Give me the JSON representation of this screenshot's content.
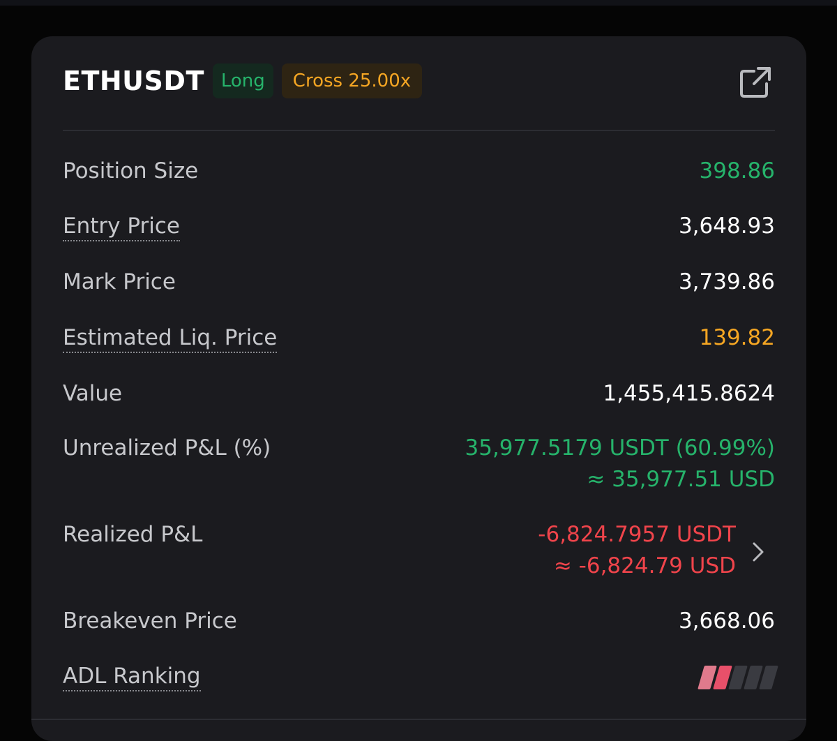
{
  "header": {
    "symbol": "ETHUSDT",
    "side_tag": "Long",
    "leverage_tag": "Cross 25.00x",
    "share_icon": "external-link-icon"
  },
  "rows": {
    "position_size": {
      "label": "Position Size",
      "value": "398.86"
    },
    "entry_price": {
      "label": "Entry Price",
      "value": "3,648.93"
    },
    "mark_price": {
      "label": "Mark Price",
      "value": "3,739.86"
    },
    "liq_price": {
      "label": "Estimated Liq. Price",
      "value": "139.82"
    },
    "value": {
      "label": "Value",
      "value": "1,455,415.8624"
    },
    "unrealized_pnl": {
      "label": "Unrealized P&L (%)",
      "value_line1": "35,977.5179 USDT (60.99%)",
      "value_line2": "≈ 35,977.51 USD"
    },
    "realized_pnl": {
      "label": "Realized P&L",
      "value_line1": "-6,824.7957 USDT",
      "value_line2": "≈ -6,824.79 USD",
      "chevron_icon": "chevron-right-icon"
    },
    "breakeven_price": {
      "label": "Breakeven Price",
      "value": "3,668.06"
    },
    "adl_ranking": {
      "label": "ADL Ranking",
      "level": 2,
      "max_level": 5
    }
  },
  "colors": {
    "green": "#26b36b",
    "orange": "#f5a623",
    "red": "#f0444b",
    "adl_active": [
      "#e07a8c",
      "#e8506a"
    ],
    "adl_inactive": "#3a3b41"
  }
}
